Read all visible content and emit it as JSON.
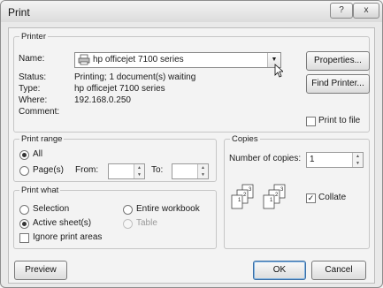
{
  "window": {
    "title": "Print",
    "help_button": "?",
    "close_button": "x"
  },
  "printer": {
    "group_label": "Printer",
    "name_label": "Name:",
    "name_value": "hp officejet 7100 series",
    "properties_button": "Properties...",
    "find_printer_button": "Find Printer...",
    "status_label": "Status:",
    "status_value": "Printing; 1 document(s) waiting",
    "type_label": "Type:",
    "type_value": "hp officejet 7100 series",
    "where_label": "Where:",
    "where_value": "192.168.0.250",
    "comment_label": "Comment:",
    "comment_value": "",
    "print_to_file_label": "Print to file",
    "print_to_file_checked": false
  },
  "print_range": {
    "group_label": "Print range",
    "all_label": "All",
    "pages_label": "Page(s)",
    "from_label": "From:",
    "to_label": "To:",
    "from_value": "",
    "to_value": "",
    "selected": "All"
  },
  "copies": {
    "group_label": "Copies",
    "number_label": "Number of copies:",
    "number_value": "1",
    "collate_label": "Collate",
    "collate_checked": true
  },
  "print_what": {
    "group_label": "Print what",
    "selection_label": "Selection",
    "entire_workbook_label": "Entire workbook",
    "active_sheets_label": "Active sheet(s)",
    "table_label": "Table",
    "ignore_print_areas_label": "Ignore print areas",
    "selected": "Active sheet(s)"
  },
  "footer": {
    "preview_button": "Preview",
    "ok_button": "OK",
    "cancel_button": "Cancel"
  }
}
